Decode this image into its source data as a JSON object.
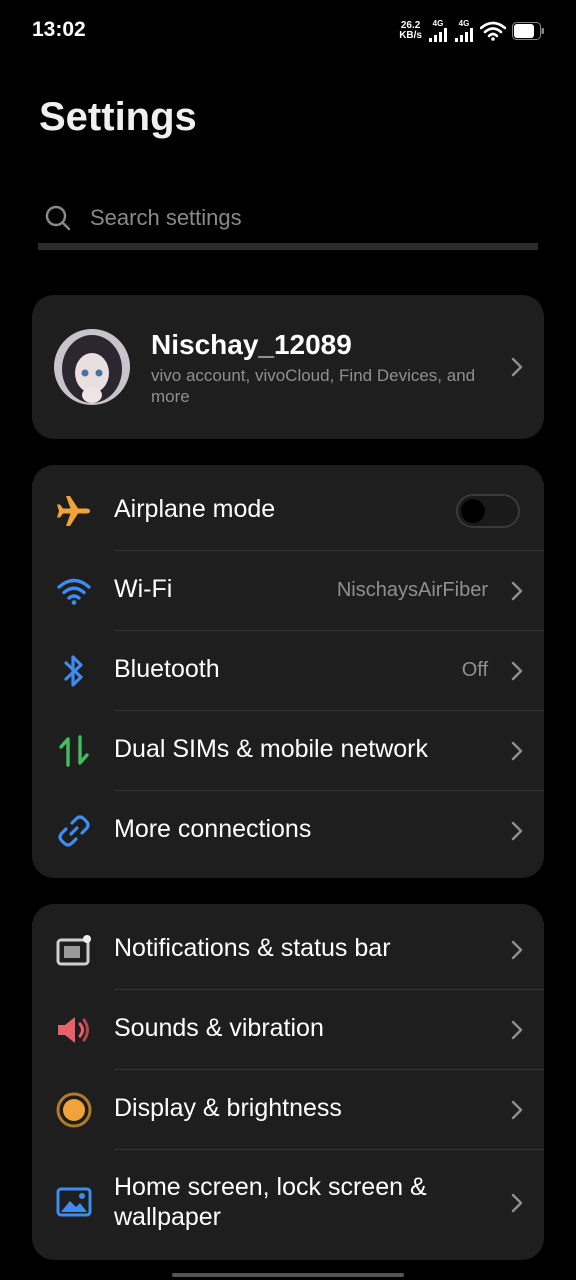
{
  "status": {
    "time": "13:02",
    "net_speed_value": "26.2",
    "net_speed_unit": "KB/s",
    "sim1_type": "4G",
    "sim2_type": "4G"
  },
  "page": {
    "title": "Settings"
  },
  "search": {
    "placeholder": "Search settings"
  },
  "account": {
    "name": "Nischay_12089",
    "subtitle": "vivo account, vivoCloud, Find Devices, and more"
  },
  "connectivity": [
    {
      "label": "Airplane mode",
      "icon": "airplane-icon",
      "color": "#f0a33a",
      "toggle": false
    },
    {
      "label": "Wi-Fi",
      "icon": "wifi-icon",
      "color": "#3f8cf0",
      "value": "NischaysAirFiber"
    },
    {
      "label": "Bluetooth",
      "icon": "bluetooth-icon",
      "color": "#3f8cf0",
      "value": "Off"
    },
    {
      "label": "Dual SIMs & mobile network",
      "icon": "sim-transfer-icon",
      "color": "#3fbf5f"
    },
    {
      "label": "More connections",
      "icon": "link-icon",
      "color": "#3f8cf0"
    }
  ],
  "system": [
    {
      "label": "Notifications & status bar",
      "icon": "notification-icon",
      "color": "#cfcfcf"
    },
    {
      "label": "Sounds & vibration",
      "icon": "speaker-icon",
      "color": "#e8606a"
    },
    {
      "label": "Display & brightness",
      "icon": "brightness-icon",
      "color": "#f0a33a"
    },
    {
      "label": "Home screen, lock screen & wallpaper",
      "icon": "wallpaper-icon",
      "color": "#3f8cf0"
    }
  ]
}
